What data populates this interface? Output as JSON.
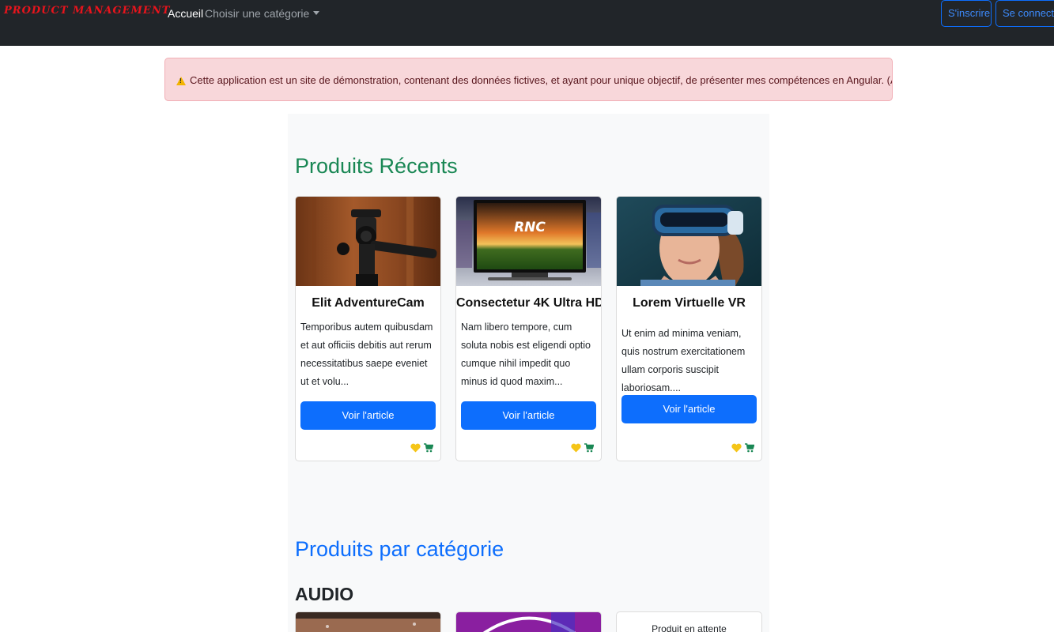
{
  "navbar": {
    "brand": "PRODUCT MANAGEMENT",
    "home": "Accueil",
    "category_dropdown": "Choisir une catégorie",
    "register": "S'inscrire",
    "login": "Se connecter"
  },
  "alert": {
    "icon": "warning-icon",
    "text": "Cette application est un site de démonstration, contenant des données fictives, et ayant pour unique objectif, de présenter mes compétences en Angular. (API en Laravel)"
  },
  "recent": {
    "title": "Produits Récents",
    "products": [
      {
        "name": "Elit AdventureCam",
        "description": "Temporibus autem quibusdam et aut officiis debitis aut rerum necessitatibus saepe eveniet ut et volu...",
        "button": "Voir l'article"
      },
      {
        "name": "Consectetur 4K Ultra HD",
        "description": "Nam libero tempore, cum soluta nobis est eligendi optio cumque nihil impedit quo minus id quod maxim...",
        "button": "Voir l'article",
        "screen_text": "RNC"
      },
      {
        "name": "Lorem Virtuelle VR",
        "description": "Ut enim ad minima veniam, quis nostrum exercitationem ullam corporis suscipit laboriosam....",
        "button": "Voir l'article"
      }
    ]
  },
  "by_category": {
    "title": "Produits par catégorie",
    "category": "AUDIO",
    "pending": "Produit en attente"
  },
  "colors": {
    "navbar": "#212529",
    "brand": "#e8141c",
    "primary": "#0d6efd",
    "success": "#198754",
    "alert_bg": "#f8d7da",
    "heart": "#f5c518",
    "cart": "#198754"
  }
}
